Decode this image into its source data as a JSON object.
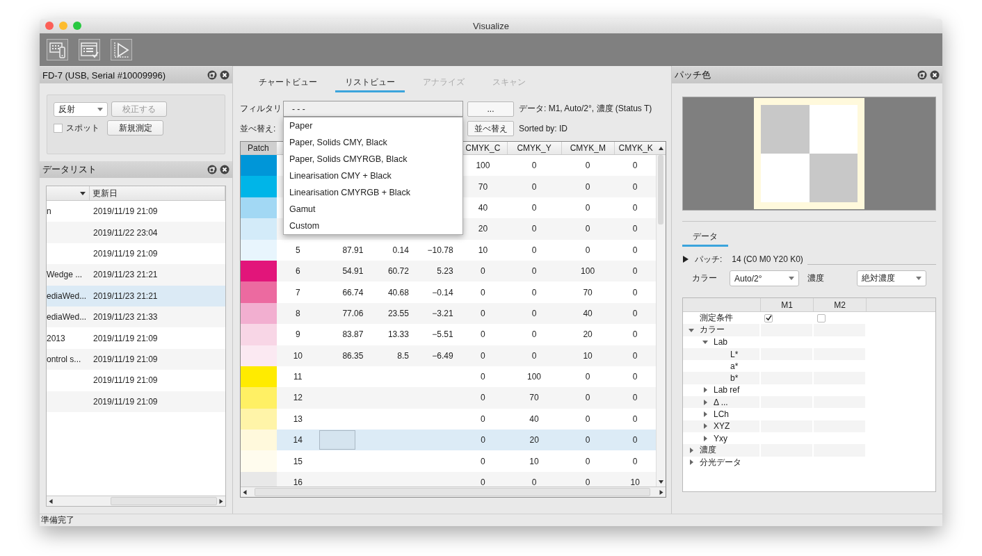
{
  "window": {
    "title": "Visualize"
  },
  "toolbar": {
    "buttons": [
      {
        "kind": "device"
      },
      {
        "kind": "checklist"
      },
      {
        "kind": "play"
      }
    ]
  },
  "device_panel": {
    "title": "FD-7 (USB, Serial #10009996)",
    "mode": "反射",
    "calibrate_button": {
      "label": "校正する",
      "disabled": true
    },
    "spot": {
      "label": "スポット",
      "checked": false
    },
    "measure_button": {
      "label": "新規測定",
      "disabled": false
    }
  },
  "data_list": {
    "title": "データリスト",
    "columns": [
      {
        "sorted": true
      },
      {
        "label": "更新日",
        "sorted": false
      }
    ],
    "rows": [
      {
        "name": "n",
        "date": "2019/11/19 21:09",
        "selected": false
      },
      {
        "date": "2019/11/22 23:04",
        "selected": false
      },
      {
        "date": "2019/11/19 21:09",
        "selected": false
      },
      {
        "name": "Wedge ...",
        "date": "2019/11/23 21:21",
        "selected": false
      },
      {
        "name": "ediaWed...",
        "date": "2019/11/23 21:21",
        "selected": true
      },
      {
        "name": "ediaWed...",
        "date": "2019/11/23 21:33",
        "selected": false
      },
      {
        "name": "2013",
        "date": "2019/11/19 21:09",
        "selected": false
      },
      {
        "name": "ontrol s...",
        "date": "2019/11/19 21:09",
        "selected": false
      },
      {
        "date": "2019/11/19 21:09",
        "selected": false
      },
      {
        "date": "2019/11/19 21:09",
        "selected": false
      }
    ]
  },
  "main": {
    "tabs": [
      {
        "label": "チャートビュー",
        "selected": false,
        "disabled": false
      },
      {
        "label": "リストビュー",
        "selected": true,
        "disabled": false
      },
      {
        "label": "アナライズ",
        "selected": false,
        "disabled": true
      },
      {
        "label": "スキャン",
        "selected": false,
        "disabled": true
      }
    ],
    "filter": {
      "label": "フィルタリ",
      "value": "- - -",
      "expanded": true,
      "options": [
        "Paper",
        "Paper, Solids CMY, Black",
        "Paper, Solids CMYRGB, Black",
        "Linearisation CMY + Black",
        "Linearisation CMYRGB + Black",
        "Gamut",
        "Custom"
      ]
    },
    "more_button": "...",
    "data_info": "データ: M1, Auto/2°, 濃度 (Status T)",
    "sort": {
      "label": "並べ替え:",
      "button": "並べ替え",
      "status": "Sorted by: ID"
    },
    "table": {
      "columns": [
        "Patch",
        null,
        null,
        null,
        null,
        "CMYK_C",
        "CMYK_Y",
        "CMYK_M",
        "CMYK_K"
      ],
      "rows": [
        {
          "color": "#0096d8",
          "cells": [
            null,
            null,
            null,
            null,
            null,
            "100",
            "0",
            "0",
            "0"
          ],
          "selected": false,
          "editing": false
        },
        {
          "color": "#00b5e8",
          "cells": [
            null,
            null,
            null,
            null,
            null,
            "70",
            "0",
            "0",
            "0"
          ],
          "selected": false,
          "editing": false
        },
        {
          "color": "#a2d8f4",
          "cells": [
            null,
            null,
            null,
            null,
            null,
            "40",
            "0",
            "0",
            "0"
          ],
          "selected": false,
          "editing": false
        },
        {
          "color": "#d3ebf9",
          "cells": [
            null,
            null,
            null,
            null,
            null,
            "20",
            "0",
            "0",
            "0"
          ],
          "selected": false,
          "editing": false
        },
        {
          "color": "#e8f5fd",
          "cells": [
            null,
            "5",
            "87.91",
            "0.14",
            "−10.78",
            "10",
            "0",
            "0",
            "0"
          ],
          "selected": false,
          "editing": false
        },
        {
          "color": "#e2157a",
          "cells": [
            null,
            "6",
            "54.91",
            "60.72",
            "5.23",
            "0",
            "0",
            "100",
            "0"
          ],
          "selected": false,
          "editing": false
        },
        {
          "color": "#ec6aa0",
          "cells": [
            null,
            "7",
            "66.74",
            "40.68",
            "−0.14",
            "0",
            "0",
            "70",
            "0"
          ],
          "selected": false,
          "editing": false
        },
        {
          "color": "#f2afd0",
          "cells": [
            null,
            "8",
            "77.06",
            "23.55",
            "−3.21",
            "0",
            "0",
            "40",
            "0"
          ],
          "selected": false,
          "editing": false
        },
        {
          "color": "#f8d6e6",
          "cells": [
            null,
            "9",
            "83.87",
            "13.33",
            "−5.51",
            "0",
            "0",
            "20",
            "0"
          ],
          "selected": false,
          "editing": false
        },
        {
          "color": "#fbe9f2",
          "cells": [
            null,
            "10",
            "86.35",
            "8.5",
            "−6.49",
            "0",
            "0",
            "10",
            "0"
          ],
          "selected": false,
          "editing": false
        },
        {
          "color": "#ffeb00",
          "cells": [
            null,
            "11",
            null,
            null,
            null,
            "0",
            "100",
            "0",
            "0"
          ],
          "selected": false,
          "editing": false
        },
        {
          "color": "#fff064",
          "cells": [
            null,
            "12",
            null,
            null,
            null,
            "0",
            "70",
            "0",
            "0"
          ],
          "selected": false,
          "editing": false
        },
        {
          "color": "#fff4a8",
          "cells": [
            null,
            "13",
            null,
            null,
            null,
            "0",
            "40",
            "0",
            "0"
          ],
          "selected": false,
          "editing": false
        },
        {
          "color": "#fff9dc",
          "cells": [
            null,
            "14",
            null,
            null,
            null,
            "0",
            "20",
            "0",
            "0"
          ],
          "selected": true,
          "editing": true
        },
        {
          "color": "#fffcee",
          "cells": [
            null,
            "15",
            null,
            null,
            null,
            "0",
            "10",
            "0",
            "0"
          ],
          "selected": false,
          "editing": false
        },
        {
          "color": "#e8e8e8",
          "cells": [
            null,
            "16",
            null,
            null,
            null,
            "0",
            "0",
            "0",
            "10"
          ],
          "selected": false,
          "editing": false
        }
      ]
    }
  },
  "patch_panel": {
    "title": "パッチ色",
    "tabs": [
      {
        "label": "データ",
        "selected": true
      }
    ],
    "patch": {
      "label": "パッチ:",
      "value": "14 (C0 M0 Y20 K0)",
      "expanded": false
    },
    "color_label": "カラー",
    "color_mode": "Auto/2°",
    "density_label": "濃度",
    "density_mode": "絶対濃度",
    "tree": {
      "columns": [
        "M1",
        "M2"
      ],
      "nodes": [
        {
          "label": "測定条件",
          "checks": [
            {
              "checked": true
            },
            {
              "checked": false
            }
          ]
        },
        {
          "label": "カラー",
          "expanded": true,
          "children": [
            {
              "label": "Lab",
              "expanded": true,
              "children": [
                {
                  "label": "L*"
                },
                {
                  "label": "a*"
                },
                {
                  "label": "b*"
                }
              ]
            },
            {
              "label": "Lab ref",
              "expanded": false
            },
            {
              "label": "Δ ...",
              "expanded": false
            },
            {
              "label": "LCh",
              "expanded": false
            },
            {
              "label": "XYZ",
              "expanded": false
            },
            {
              "label": "Yxy",
              "expanded": false
            }
          ]
        },
        {
          "label": "濃度",
          "expanded": false
        },
        {
          "label": "分光データ",
          "expanded": false
        }
      ]
    }
  },
  "status_bar": {
    "text": "準備完了"
  }
}
